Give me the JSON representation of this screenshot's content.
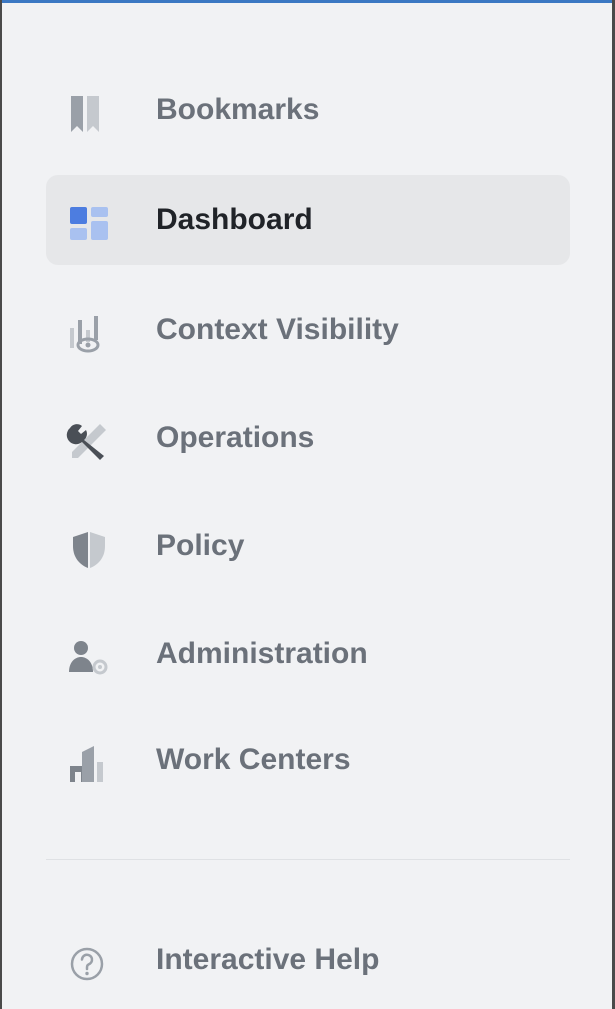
{
  "colors": {
    "accent": "#3b78c3",
    "background": "#f1f2f4",
    "active_bg": "#e6e7e9",
    "text": "#6b717a",
    "text_active": "#202328",
    "icon": "#9aa0a8",
    "icon_light": "#c5c9ce",
    "icon_active": "#4d7de0",
    "icon_active_light": "#a9c1f0"
  },
  "nav": {
    "items": [
      {
        "label": "Bookmarks",
        "icon": "bookmark-icon",
        "active": false
      },
      {
        "label": "Dashboard",
        "icon": "dashboard-icon",
        "active": true
      },
      {
        "label": "Context Visibility",
        "icon": "context-visibility-icon",
        "active": false
      },
      {
        "label": "Operations",
        "icon": "tools-icon",
        "active": false
      },
      {
        "label": "Policy",
        "icon": "shield-icon",
        "active": false
      },
      {
        "label": "Administration",
        "icon": "admin-gear-icon",
        "active": false
      },
      {
        "label": "Work Centers",
        "icon": "buildings-icon",
        "active": false
      }
    ],
    "help": {
      "label": "Interactive Help",
      "icon": "help-icon"
    }
  }
}
